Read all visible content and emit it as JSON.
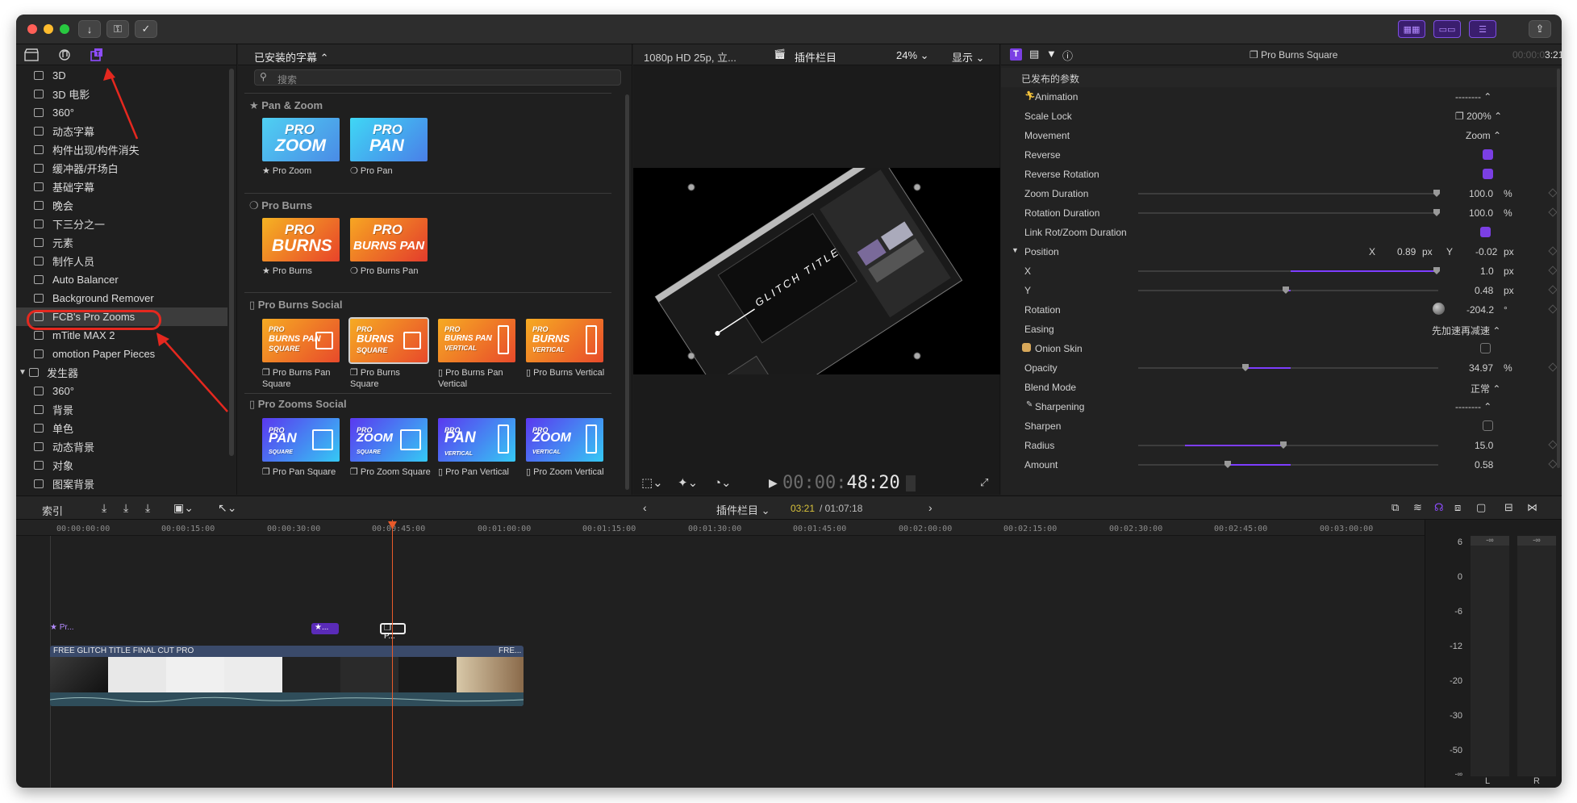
{
  "toolbar": {
    "download_icon": "↓",
    "key_icon": "⚿",
    "check_icon": "✓",
    "share_icon": "⇪"
  },
  "sidebar": {
    "items": [
      {
        "label": "3D"
      },
      {
        "label": "3D 电影"
      },
      {
        "label": "360°"
      },
      {
        "label": "动态字幕"
      },
      {
        "label": "构件出现/构件消失"
      },
      {
        "label": "缓冲器/开场白"
      },
      {
        "label": "基础字幕"
      },
      {
        "label": "晚会"
      },
      {
        "label": "下三分之一"
      },
      {
        "label": "元素"
      },
      {
        "label": "制作人员"
      },
      {
        "label": "Auto Balancer"
      },
      {
        "label": "Background Remover"
      },
      {
        "label": "FCB's Pro Zooms"
      },
      {
        "label": "mTitle MAX 2"
      },
      {
        "label": "omotion Paper Pieces"
      }
    ],
    "generators_label": "发生器",
    "generator_items": [
      {
        "label": "360°"
      },
      {
        "label": "背景"
      },
      {
        "label": "单色"
      },
      {
        "label": "动态背景"
      },
      {
        "label": "对象"
      },
      {
        "label": "图案背景"
      }
    ]
  },
  "browser": {
    "title": "已安装的字幕",
    "search_placeholder": "搜索",
    "sections": {
      "pan_zoom": "★ Pan & Zoom",
      "pro_burns": "❍ Pro Burns",
      "pro_burns_social": "▯ Pro Burns Social",
      "pro_zooms_social": "▯ Pro Zooms Social"
    },
    "items": {
      "pro_zoom": {
        "l1": "PRO",
        "l2": "ZOOM",
        "label": "★ Pro Zoom"
      },
      "pro_pan": {
        "l1": "PRO",
        "l2": "PAN",
        "label": "❍ Pro Pan"
      },
      "pro_burns": {
        "l1": "PRO",
        "l2": "BURNS",
        "label": "★ Pro Burns"
      },
      "pro_burns_pan": {
        "l1": "PRO",
        "l2": "BURNS PAN",
        "label": "❍ Pro Burns Pan"
      },
      "burns_pan_square": {
        "l1": "PRO",
        "l2": "BURNS PAN",
        "l3": "SQUARE",
        "label": "❐ Pro Burns Pan Square"
      },
      "burns_square": {
        "l1": "PRO",
        "l2": "BURNS",
        "l3": "SQUARE",
        "label": "❐ Pro Burns Square"
      },
      "burns_pan_vertical": {
        "l1": "PRO",
        "l2": "BURNS PAN",
        "l3": "VERTICAL",
        "label": "▯ Pro Burns Pan Vertical"
      },
      "burns_vertical": {
        "l1": "PRO",
        "l2": "BURNS",
        "l3": "VERTICAL",
        "label": "▯ Pro Burns Vertical"
      },
      "pan_square": {
        "l1": "PRO",
        "l2": "PAN",
        "l3": "SQUARE",
        "label": "❐ Pro Pan Square"
      },
      "zoom_square": {
        "l1": "PRO",
        "l2": "ZOOM",
        "l3": "SQUARE",
        "label": "❐ Pro Zoom Square"
      },
      "pan_vertical": {
        "l1": "PRO",
        "l2": "PAN",
        "l3": "VERTICAL",
        "label": "▯ Pro Pan Vertical"
      },
      "zoom_vertical": {
        "l1": "PRO",
        "l2": "ZOOM",
        "l3": "VERTICAL",
        "label": "▯ Pro Zoom Vertical"
      }
    }
  },
  "viewer": {
    "format": "1080p HD 25p, 立...",
    "project": "插件栏目",
    "zoom": "24%",
    "display": "显示",
    "timecode_dim": "00:00:",
    "timecode_bright": "48:20",
    "overlay_text": "GLITCH TITLE"
  },
  "inspector": {
    "title": "❐ Pro Burns Square",
    "timecode_dim": "00:00:0",
    "timecode": "3:21",
    "published_params": "已发布的参数",
    "params": {
      "animation": {
        "name": "Animation",
        "value": "--------"
      },
      "scale_lock": {
        "name": "Scale Lock",
        "value": "❐ 200%"
      },
      "movement": {
        "name": "Movement",
        "value": "Zoom"
      },
      "reverse": {
        "name": "Reverse"
      },
      "reverse_rotation": {
        "name": "Reverse Rotation"
      },
      "zoom_duration": {
        "name": "Zoom Duration",
        "value": "100.0",
        "unit": "%"
      },
      "rotation_duration": {
        "name": "Rotation Duration",
        "value": "100.0",
        "unit": "%"
      },
      "link_rot": {
        "name": "Link Rot/Zoom Duration"
      },
      "position": {
        "name": "Position",
        "x_label": "X",
        "x": "0.89",
        "x_unit": "px",
        "y_label": "Y",
        "y": "-0.02",
        "y_unit": "px"
      },
      "x": {
        "name": "X",
        "value": "1.0",
        "unit": "px"
      },
      "y": {
        "name": "Y",
        "value": "0.48",
        "unit": "px"
      },
      "rotation": {
        "name": "Rotation",
        "value": "-204.2",
        "unit": "°"
      },
      "easing": {
        "name": "Easing",
        "value": "先加速再减速"
      },
      "onion_skin": {
        "name": "Onion Skin"
      },
      "opacity": {
        "name": "Opacity",
        "value": "34.97",
        "unit": "%"
      },
      "blend_mode": {
        "name": "Blend Mode",
        "value": "正常"
      },
      "sharpening": {
        "name": "Sharpening",
        "value": "--------"
      },
      "sharpen": {
        "name": "Sharpen"
      },
      "radius": {
        "name": "Radius",
        "value": "15.0"
      },
      "amount": {
        "name": "Amount",
        "value": "0.58"
      }
    }
  },
  "timeline_bar": {
    "index": "索引",
    "project": "插件栏目",
    "position": "03:21",
    "duration": "/ 01:07:18"
  },
  "timeline": {
    "ruler": [
      "00:00:00:00",
      "00:00:15:00",
      "00:00:30:00",
      "00:00:45:00",
      "00:01:00:00",
      "00:01:15:00",
      "00:01:30:00",
      "00:01:45:00",
      "00:02:00:00",
      "00:02:15:00",
      "00:02:30:00",
      "00:02:45:00",
      "00:03:00:00"
    ],
    "title_clip_1": "★ Pr...",
    "title_clip_2": "★...",
    "title_clip_3": "❐ P...",
    "video_clip_label": "FREE GLITCH TITLE  FINAL CUT PRO",
    "video_clip_label2": "FRE..."
  },
  "meters": {
    "scale": [
      "6",
      "0",
      "-6",
      "-12",
      "-20",
      "-30",
      "-50",
      "-∞"
    ],
    "peak_l": "-∞",
    "peak_r": "-∞",
    "left": "L",
    "right": "R"
  },
  "colors": {
    "accent": "#7b3fe4",
    "annotation": "#e5281f",
    "playhead": "#e85a2a"
  }
}
